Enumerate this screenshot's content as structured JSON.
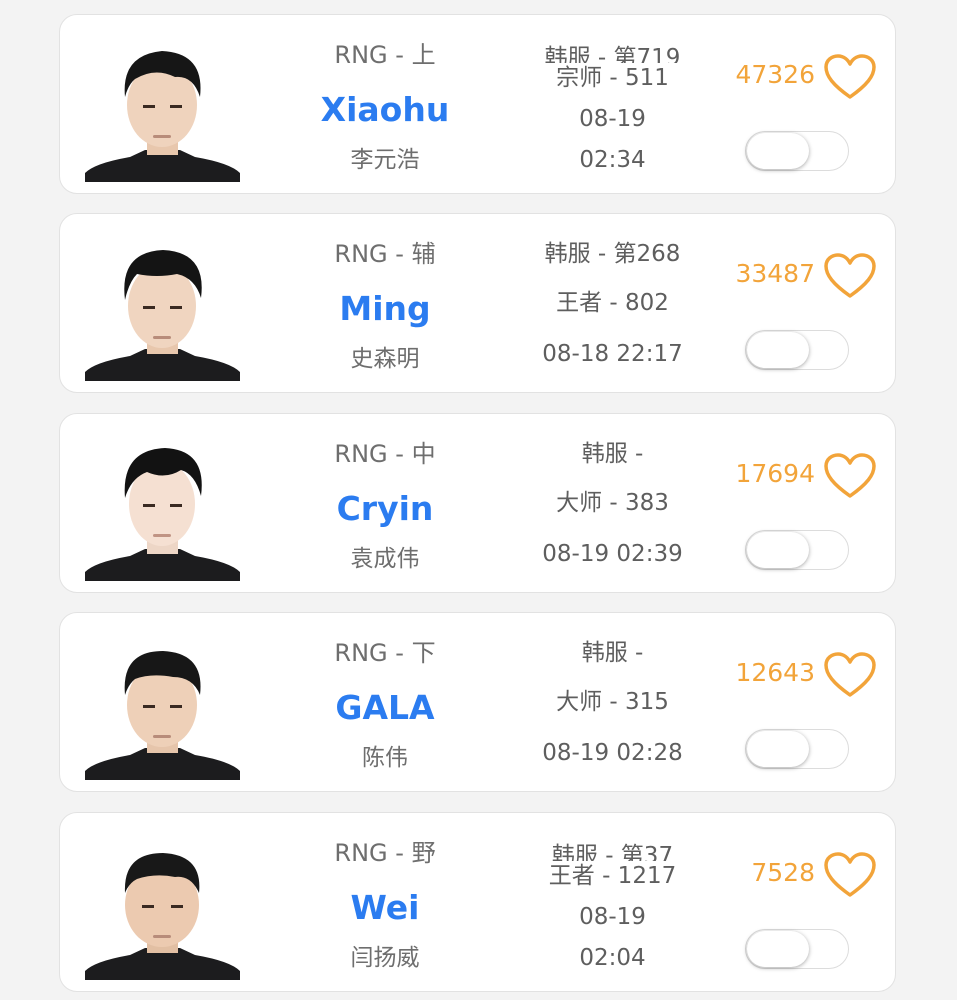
{
  "accent": {
    "name_color": "#2b7cf0",
    "likes_color": "#f2a43a"
  },
  "players": [
    {
      "team_pos": "RNG - 上",
      "nickname": "Xiaohu",
      "realname": "李元浩",
      "server_rank": "韩服 - 第719",
      "tier": "宗师 - 511",
      "date": "08-19",
      "time": "02:34",
      "likes": "47326",
      "heart_icon": "heart-outline-icon",
      "toggle_on": false
    },
    {
      "team_pos": "RNG - 辅",
      "nickname": "Ming",
      "realname": "史森明",
      "server_rank": "韩服 - 第268",
      "tier": "王者 - 802",
      "datetime": "08-18 22:17",
      "likes": "33487",
      "heart_icon": "heart-outline-icon",
      "toggle_on": false
    },
    {
      "team_pos": "RNG - 中",
      "nickname": "Cryin",
      "realname": "袁成伟",
      "server_rank": "韩服 -",
      "tier": "大师 - 383",
      "datetime": "08-19 02:39",
      "likes": "17694",
      "heart_icon": "heart-outline-icon",
      "toggle_on": false
    },
    {
      "team_pos": "RNG - 下",
      "nickname": "GALA",
      "realname": "陈伟",
      "server_rank": "韩服 -",
      "tier": "大师 - 315",
      "datetime": "08-19 02:28",
      "likes": "12643",
      "heart_icon": "heart-outline-icon",
      "toggle_on": false
    },
    {
      "team_pos": "RNG - 野",
      "nickname": "Wei",
      "realname": "闫扬威",
      "server_rank": "韩服 - 第37",
      "tier": "王者 - 1217",
      "date": "08-19",
      "time": "02:04",
      "likes": "7528",
      "heart_icon": "heart-outline-icon",
      "toggle_on": false
    }
  ]
}
